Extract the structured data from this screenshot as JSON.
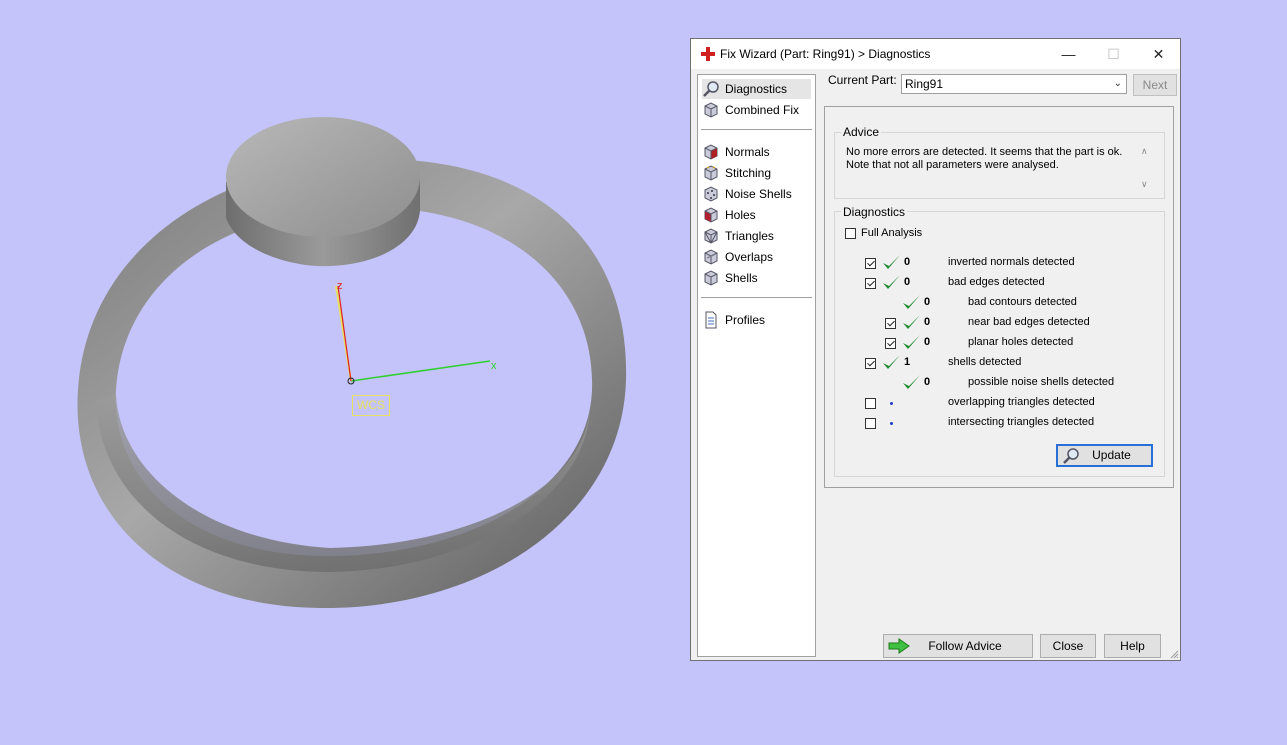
{
  "viewport": {
    "axis_x": "x",
    "axis_z": "z",
    "wcs_label": "WCS"
  },
  "window": {
    "title": "Fix Wizard (Part: Ring91) > Diagnostics",
    "minimize_glyph": "—",
    "maximize_glyph": "☐",
    "close_glyph": "✕"
  },
  "nav": {
    "items": [
      {
        "label": "Diagnostics",
        "icon": "magnifier-icon",
        "selected": true
      },
      {
        "label": "Combined Fix",
        "icon": "cube-icon"
      },
      {
        "label": "Normals",
        "icon": "normals-cube-icon"
      },
      {
        "label": "Stitching",
        "icon": "stitching-cube-icon"
      },
      {
        "label": "Noise Shells",
        "icon": "noise-shells-cube-icon"
      },
      {
        "label": "Holes",
        "icon": "holes-cube-icon"
      },
      {
        "label": "Triangles",
        "icon": "triangles-cube-icon"
      },
      {
        "label": "Overlaps",
        "icon": "overlaps-cube-icon"
      },
      {
        "label": "Shells",
        "icon": "shells-cube-icon"
      },
      {
        "label": "Profiles",
        "icon": "document-icon"
      }
    ]
  },
  "current_part": {
    "label": "Current Part:",
    "value": "Ring91",
    "next_label": "Next"
  },
  "advice": {
    "title": "Advice",
    "line1": "No more errors are detected. It seems that the part is ok.",
    "line2": "Note that not all parameters were analysed."
  },
  "diagnostics": {
    "title": "Diagnostics",
    "full_analysis_label": "Full Analysis",
    "rows": [
      {
        "checkbox": true,
        "checked": true,
        "status": "ok",
        "count": "0",
        "text": "inverted normals detected",
        "indent": 0
      },
      {
        "checkbox": true,
        "checked": true,
        "status": "ok",
        "count": "0",
        "text": "bad edges detected",
        "indent": 0
      },
      {
        "checkbox": false,
        "checked": false,
        "status": "ok",
        "count": "0",
        "text": "bad contours detected",
        "indent": 1
      },
      {
        "checkbox": true,
        "checked": true,
        "status": "ok",
        "count": "0",
        "text": "near bad edges detected",
        "indent": 1
      },
      {
        "checkbox": true,
        "checked": true,
        "status": "ok",
        "count": "0",
        "text": "planar holes detected",
        "indent": 1
      },
      {
        "checkbox": true,
        "checked": true,
        "status": "ok",
        "count": "1",
        "text": "shells detected",
        "indent": 0
      },
      {
        "checkbox": false,
        "checked": false,
        "status": "ok",
        "count": "0",
        "text": "possible noise shells detected",
        "indent": 1
      },
      {
        "checkbox": true,
        "checked": false,
        "status": "not-run",
        "count": "",
        "text": "overlapping triangles detected",
        "indent": 0
      },
      {
        "checkbox": true,
        "checked": false,
        "status": "not-run",
        "count": "",
        "text": "intersecting triangles detected",
        "indent": 0
      }
    ],
    "update_label": "Update"
  },
  "buttons": {
    "follow_advice": "Follow Advice",
    "close": "Close",
    "help": "Help"
  },
  "colors": {
    "background": "#c4c4fa",
    "ok_check": "#1e8a2e",
    "not_run_dot": "#1e3cc8",
    "x_axis": "#30d030",
    "z_axis": "#e02020",
    "wcs": "#e8e060"
  }
}
